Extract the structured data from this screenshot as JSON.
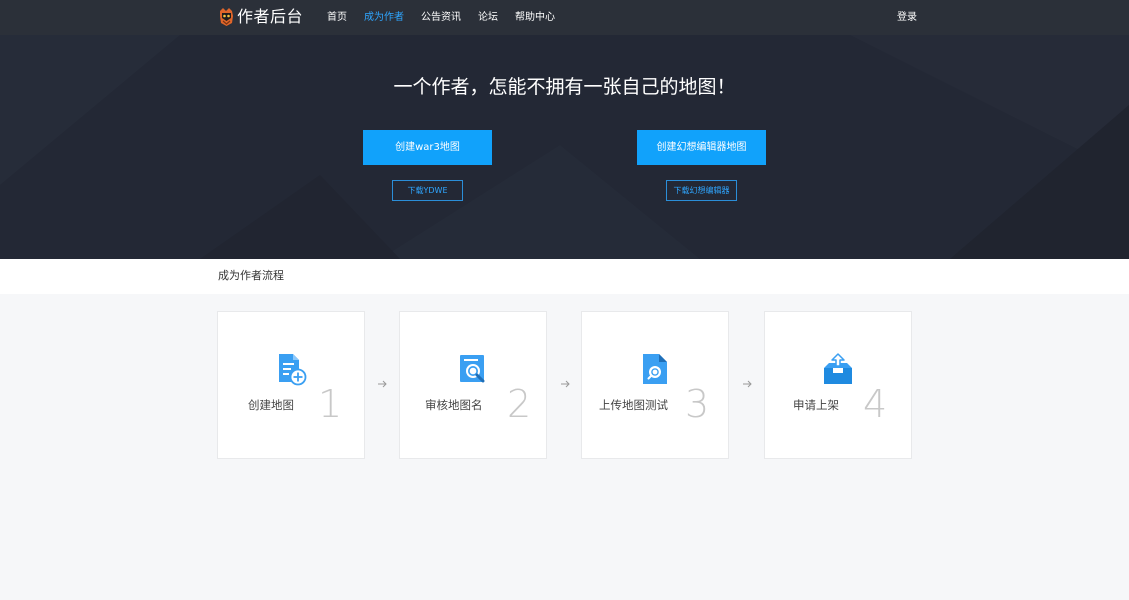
{
  "header": {
    "logo_text": "作者后台",
    "nav": [
      "首页",
      "成为作者",
      "公告资讯",
      "论坛",
      "帮助中心"
    ],
    "active_index": 1,
    "login_label": "登录"
  },
  "hero": {
    "title": "一个作者，怎能不拥有一张自己的地图！",
    "buttons": [
      {
        "primary_label": "创建war3地图",
        "download_label": "下载YDWE"
      },
      {
        "primary_label": "创建幻想编辑器地图",
        "download_label": "下载幻想编辑器"
      }
    ]
  },
  "section": {
    "title": "成为作者流程"
  },
  "steps": [
    {
      "number": "1",
      "label": "创建地图",
      "icon": "create-map-icon"
    },
    {
      "number": "2",
      "label": "审核地图名",
      "icon": "review-name-icon"
    },
    {
      "number": "3",
      "label": "上传地图测试",
      "icon": "upload-test-icon"
    },
    {
      "number": "4",
      "label": "申请上架",
      "icon": "apply-listing-icon"
    }
  ],
  "colors": {
    "accent": "#11a2fb",
    "nav_active": "#2fa6ff",
    "header_bg": "#2b3039",
    "hero_bg": "#222734"
  }
}
